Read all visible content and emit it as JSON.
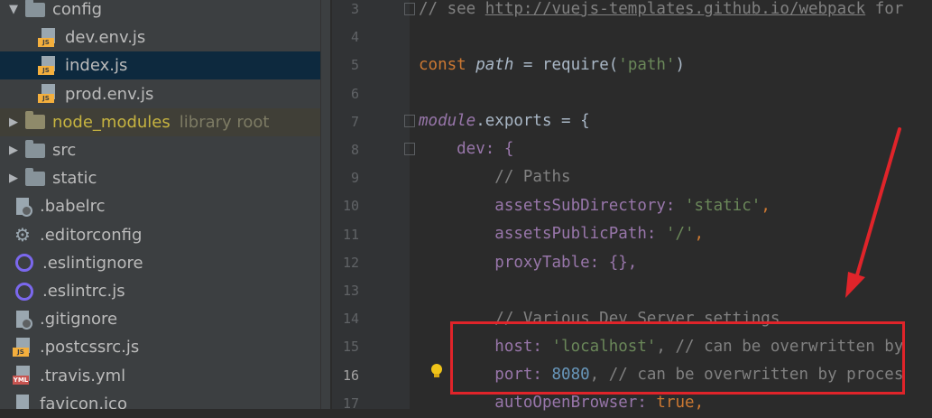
{
  "tree": [
    {
      "label": "config",
      "kind": "folder-open",
      "arrow": "▼",
      "indent": 8,
      "state": ""
    },
    {
      "label": "dev.env.js",
      "kind": "js",
      "arrow": "",
      "indent": 42,
      "state": ""
    },
    {
      "label": "index.js",
      "kind": "js",
      "arrow": "",
      "indent": 42,
      "state": "selected"
    },
    {
      "label": "prod.env.js",
      "kind": "js",
      "arrow": "",
      "indent": 42,
      "state": ""
    },
    {
      "label": "node_modules",
      "sub": "library root",
      "kind": "folder-orange",
      "arrow": "▶",
      "indent": 8,
      "state": "excluded"
    },
    {
      "label": "src",
      "kind": "folder",
      "arrow": "▶",
      "indent": 8,
      "state": ""
    },
    {
      "label": "static",
      "kind": "folder",
      "arrow": "▶",
      "indent": 8,
      "state": ""
    },
    {
      "label": ".babelrc",
      "kind": "config",
      "arrow": "",
      "indent": 14,
      "state": ""
    },
    {
      "label": ".editorconfig",
      "kind": "gear",
      "arrow": "",
      "indent": 14,
      "state": ""
    },
    {
      "label": ".eslintignore",
      "kind": "eslint",
      "arrow": "",
      "indent": 14,
      "state": ""
    },
    {
      "label": ".eslintrc.js",
      "kind": "eslint",
      "arrow": "",
      "indent": 14,
      "state": ""
    },
    {
      "label": ".gitignore",
      "kind": "ignore",
      "arrow": "",
      "indent": 14,
      "state": ""
    },
    {
      "label": ".postcssrc.js",
      "kind": "js",
      "arrow": "",
      "indent": 14,
      "state": ""
    },
    {
      "label": ".travis.yml",
      "kind": "yml",
      "arrow": "",
      "indent": 14,
      "state": ""
    },
    {
      "label": "favicon.ico",
      "kind": "plain",
      "arrow": "",
      "indent": 14,
      "state": ""
    }
  ],
  "tags": {
    "js": "JS",
    "yml": "YML"
  },
  "lines": [
    3,
    4,
    5,
    6,
    7,
    8,
    9,
    10,
    11,
    12,
    13,
    14,
    15,
    16,
    17
  ],
  "current_line": 16,
  "code": {
    "l3_comment": "// see ",
    "l3_link": "http://vuejs-templates.github.io/webpack",
    "l3_tail": " for",
    "l5_const": "const ",
    "l5_var": "path",
    "l5_eq": " = require(",
    "l5_str": "'path'",
    "l5_close": ")",
    "l7_module": "module",
    "l7_rest": ".exports = {",
    "l8": "    dev: {",
    "l9": "        // Paths",
    "l10_prop": "        assetsSubDirectory: ",
    "l10_str": "'static'",
    "l10_tail": ",",
    "l11_prop": "        assetsPublicPath: ",
    "l11_str": "'/'",
    "l11_tail": ",",
    "l12": "        proxyTable: {},",
    "l14": "        // Various Dev Server settings",
    "l15_prop": "        host: ",
    "l15_str": "'localhost'",
    "l15_com": ", // can be overwritten by",
    "l16_prop": "        port: ",
    "l16_num": "8080",
    "l16_com": ", // can be overwritten by proces",
    "l17_prop": "        autoOpenBrowser: ",
    "l17_kw": "true",
    "l17_tail": ","
  },
  "colors": {
    "annotation": "#e0242a",
    "selected_row": "#0d293e",
    "background": "#2b2b2b"
  },
  "icons": [
    "folder-icon",
    "js-file-icon",
    "gear-icon",
    "eslint-icon",
    "yml-file-icon",
    "lightbulb-icon",
    "fold-marker-icon"
  ]
}
